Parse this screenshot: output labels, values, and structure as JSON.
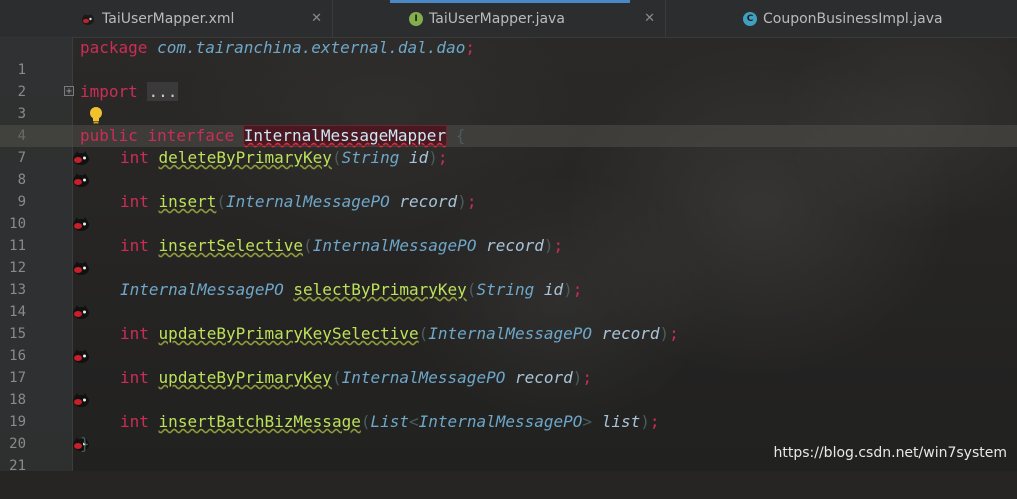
{
  "tabs": [
    {
      "label": "TaiUserMapper.xml",
      "icon": "mybatis-xml-icon",
      "close": "✕"
    },
    {
      "label": "TaiUserMapper.java",
      "icon": "interface-icon",
      "icon_letter": "I",
      "close": "✕"
    },
    {
      "label": "CouponBusinessImpl.java",
      "icon": "class-icon",
      "icon_letter": "C"
    }
  ],
  "lines": [
    {
      "num": "1"
    },
    {
      "num": "2"
    },
    {
      "num": "3"
    },
    {
      "num": "4"
    },
    {
      "num": "7"
    },
    {
      "num": "8"
    },
    {
      "num": "9"
    },
    {
      "num": "10"
    },
    {
      "num": "11"
    },
    {
      "num": "12"
    },
    {
      "num": "13"
    },
    {
      "num": "14"
    },
    {
      "num": "15"
    },
    {
      "num": "16"
    },
    {
      "num": "17"
    },
    {
      "num": "18"
    },
    {
      "num": "19"
    },
    {
      "num": "20"
    },
    {
      "num": "21"
    }
  ],
  "code": {
    "package_kw": "package",
    "package_name": "com.tairanchina.external.dal.dao",
    "semi": ";",
    "import_kw": "import",
    "import_dots": "...",
    "public_kw": "public",
    "interface_kw": "interface",
    "interface_name": "InternalMessageMapper",
    "open_brace": "{",
    "close_brace": "}",
    "int_kw": "int",
    "paren_open": "(",
    "paren_close": ")",
    "lt": "<",
    "gt": ">",
    "m1": "deleteByPrimaryKey",
    "m2": "insert",
    "m3": "insertSelective",
    "m4": "selectByPrimaryKey",
    "m5": "updateByPrimaryKeySelective",
    "m6": "updateByPrimaryKey",
    "m7": "insertBatchBizMessage",
    "type_string": "String",
    "type_po": "InternalMessagePO",
    "type_list": "List",
    "param_id": "id",
    "param_record": "record",
    "param_list": "list"
  },
  "watermark": "https://blog.csdn.net/win7system",
  "colors": {
    "keyword": "#cc2d56",
    "type": "#6ea7c9",
    "method": "#bde25a",
    "param": "#a8c4d8",
    "tab_accent": "#4a88c7"
  }
}
